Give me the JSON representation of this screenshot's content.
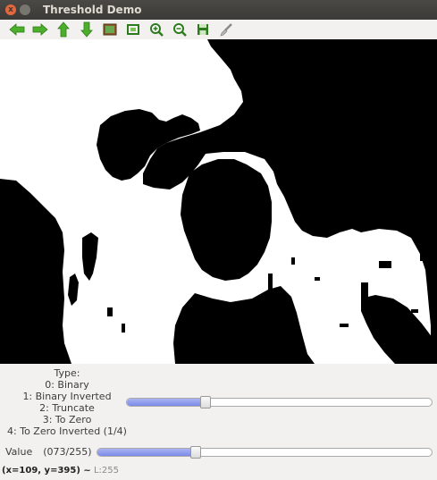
{
  "window": {
    "title": "Threshold Demo",
    "close_glyph": "x"
  },
  "toolbar": {
    "buttons": [
      {
        "name": "pan-left-button",
        "icon": "arrow-left-icon",
        "color": "#4caf2a"
      },
      {
        "name": "pan-right-button",
        "icon": "arrow-right-icon",
        "color": "#4caf2a"
      },
      {
        "name": "pan-up-button",
        "icon": "arrow-up-icon",
        "color": "#4caf2a"
      },
      {
        "name": "pan-down-button",
        "icon": "arrow-down-icon",
        "color": "#4caf2a"
      },
      {
        "name": "zoom-fit-button",
        "icon": "image-icon",
        "color": "#5a8a2a"
      },
      {
        "name": "zoom-original-button",
        "icon": "zoom-original-icon",
        "color": "#2e7a1e"
      },
      {
        "name": "zoom-in-button",
        "icon": "zoom-in-icon",
        "color": "#2e7a1e"
      },
      {
        "name": "zoom-out-button",
        "icon": "zoom-out-icon",
        "color": "#2e7a1e"
      },
      {
        "name": "save-button",
        "icon": "floppy-save-icon",
        "color": "#2e7a1e"
      },
      {
        "name": "properties-button",
        "icon": "brush-icon",
        "color": "#9a9a9a"
      }
    ]
  },
  "controls": {
    "type_lines": [
      "Type:",
      "0: Binary",
      "1: Binary Inverted",
      "2: Truncate",
      "3: To Zero",
      "4: To Zero Inverted (1/4)"
    ],
    "type_value": 1,
    "type_max": 4,
    "value_label": "Value",
    "value_readout": "(073/255)",
    "value": 73,
    "value_max": 255,
    "slider_color": "#7c8be8"
  },
  "status": {
    "coords": "(x=109, y=395) ~",
    "lum": "L:255"
  }
}
